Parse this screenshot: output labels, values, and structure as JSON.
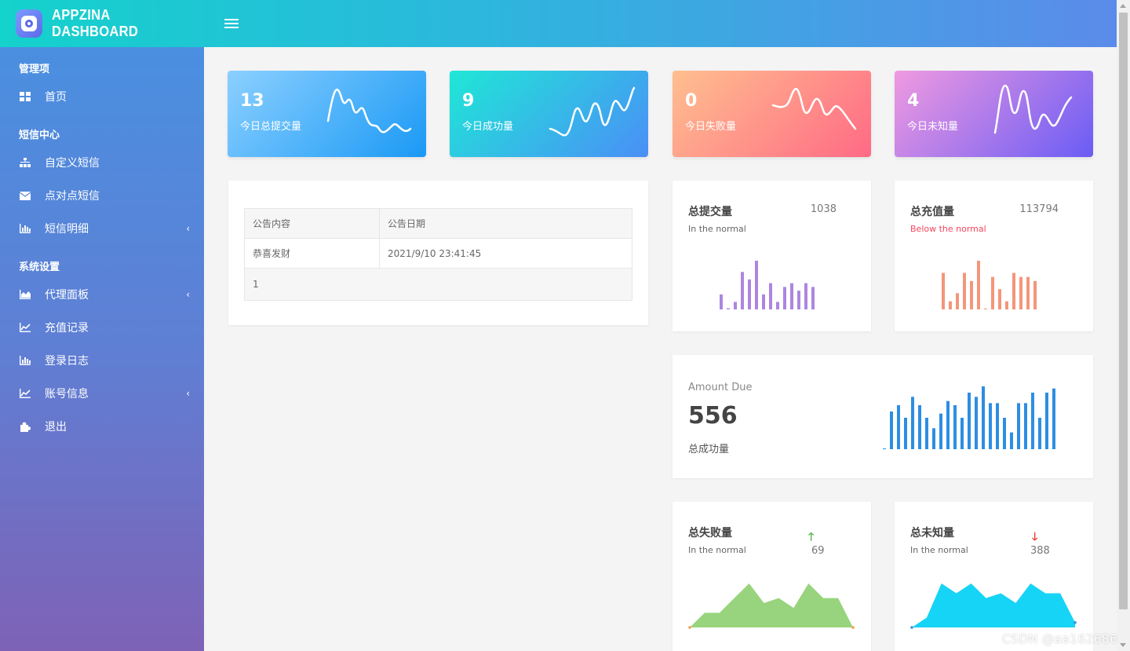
{
  "brand": {
    "name": "APPZINA DASHBOARD"
  },
  "sidebar": {
    "sections": [
      {
        "title": "管理项",
        "items": [
          {
            "label": "首页",
            "icon": "dashboard-icon"
          }
        ]
      },
      {
        "title": "短信中心",
        "items": [
          {
            "label": "自定义短信",
            "icon": "sitemap-icon"
          },
          {
            "label": "点对点短信",
            "icon": "envelope-icon"
          },
          {
            "label": "短信明细",
            "icon": "bar-chart-icon",
            "arrow": "‹"
          }
        ]
      },
      {
        "title": "系统设置",
        "items": [
          {
            "label": "代理面板",
            "icon": "area-chart-icon",
            "arrow": "‹"
          },
          {
            "label": "充值记录",
            "icon": "line-chart-icon"
          },
          {
            "label": "登录日志",
            "icon": "bar-chart-icon"
          },
          {
            "label": "账号信息",
            "icon": "line-chart-icon",
            "arrow": "‹"
          },
          {
            "label": "退出",
            "icon": "puzzle-icon"
          }
        ]
      }
    ]
  },
  "stats": [
    {
      "value": "13",
      "label": "今日总提交量"
    },
    {
      "value": "9",
      "label": "今日成功量"
    },
    {
      "value": "0",
      "label": "今日失败量"
    },
    {
      "value": "4",
      "label": "今日未知量"
    }
  ],
  "notice": {
    "headers": [
      "公告内容",
      "公告日期"
    ],
    "rows": [
      [
        "恭喜发财",
        "2021/9/10 23:41:45"
      ]
    ],
    "page": "1"
  },
  "mini_cards": [
    {
      "title": "总提交量",
      "value": "1038",
      "status": "In the normal",
      "color": "#ad86e0"
    },
    {
      "title": "总充值量",
      "value": "113794",
      "status": "Below the normal",
      "color": "#f4967a"
    }
  ],
  "amount": {
    "label": "Amount Due",
    "value": "556",
    "caption": "总成功量",
    "color": "#2d8ee2"
  },
  "area_cards": [
    {
      "title": "总失败量",
      "status": "In the normal",
      "value": "69",
      "arrow": "🡑",
      "arrow_color": "#55b94a",
      "fill": "#98d47d"
    },
    {
      "title": "总未知量",
      "status": "In the normal",
      "value": "388",
      "arrow": "🡓",
      "arrow_color": "#e8452f",
      "fill": "#16d4f5"
    }
  ],
  "chart_data": [
    {
      "type": "bar",
      "title": "总提交量",
      "values": [
        4,
        0.3,
        2,
        10,
        8,
        13,
        4,
        7,
        2,
        6,
        7,
        5,
        7,
        6
      ]
    },
    {
      "type": "bar",
      "title": "总充值量",
      "values": [
        9,
        2,
        4,
        9,
        7,
        12,
        0.2,
        8,
        5,
        2,
        9,
        8,
        8,
        7
      ]
    },
    {
      "type": "bar",
      "title": "Amount Due",
      "values": [
        0.3,
        18,
        21,
        15,
        25,
        21,
        15,
        10,
        17,
        23,
        21,
        15,
        27,
        25,
        30,
        22,
        22,
        15,
        8,
        22,
        22,
        27,
        15,
        27,
        29
      ]
    },
    {
      "type": "area",
      "title": "总失败量",
      "values": [
        0,
        3,
        3,
        6,
        9,
        5,
        6,
        4,
        9,
        6,
        6,
        0
      ]
    },
    {
      "type": "area",
      "title": "总未知量",
      "values": [
        0,
        2,
        9,
        7,
        9,
        6,
        7,
        5,
        9,
        7,
        7,
        1
      ]
    }
  ],
  "watermark": "CSDN @aa162686"
}
